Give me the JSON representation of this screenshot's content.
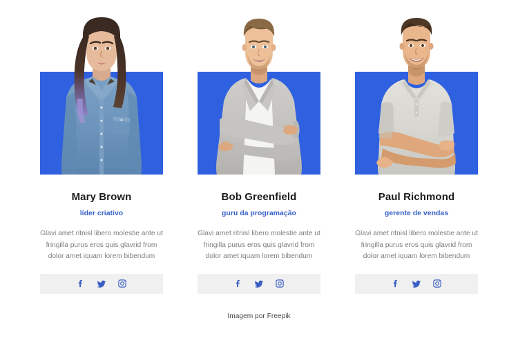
{
  "page": {
    "background_color": "#ffffff",
    "accent_blue": "#2f60e0",
    "role_color": "#3a63c8",
    "social_icon_color": "#3a5fc4",
    "social_bar_color": "#f0f0f0",
    "credit": "Imagem por Freepik"
  },
  "team": {
    "members": [
      {
        "name": "Mary Brown",
        "role": "líder criativo",
        "bio": "Glavi amet ritnisl libero molestie ante ut fringilla purus eros quis glavrid from dolor amet iquam lorem bibendum",
        "photo_alt": "woman-with-long-ombre-hair-in-denim-shirt",
        "social": [
          {
            "icon": "facebook-icon",
            "label": "Facebook"
          },
          {
            "icon": "twitter-icon",
            "label": "Twitter"
          },
          {
            "icon": "instagram-icon",
            "label": "Instagram"
          }
        ]
      },
      {
        "name": "Bob Greenfield",
        "role": "guru da programação",
        "bio": "Glavi amet ritnisl libero molestie ante ut fringilla purus eros quis glavrid from dolor amet iquam lorem bibendum",
        "photo_alt": "man-in-grey-blazer-with-arms-crossed",
        "social": [
          {
            "icon": "facebook-icon",
            "label": "Facebook"
          },
          {
            "icon": "twitter-icon",
            "label": "Twitter"
          },
          {
            "icon": "instagram-icon",
            "label": "Instagram"
          }
        ]
      },
      {
        "name": "Paul Richmond",
        "role": "gerente de vendas",
        "bio": "Glavi amet ritnisl libero molestie ante ut fringilla purus eros quis glavrid from dolor amet iquam lorem bibendum",
        "photo_alt": "man-in-light-grey-polo-with-arms-crossed",
        "social": [
          {
            "icon": "facebook-icon",
            "label": "Facebook"
          },
          {
            "icon": "twitter-icon",
            "label": "Twitter"
          },
          {
            "icon": "instagram-icon",
            "label": "Instagram"
          }
        ]
      }
    ]
  }
}
